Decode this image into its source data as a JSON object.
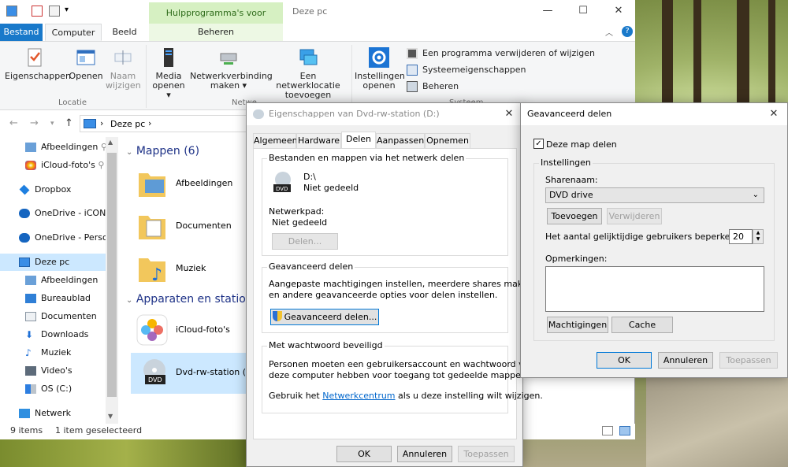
{
  "explorer": {
    "ctx_tab": "Hulpprogramma's voor stations",
    "title": "Deze pc",
    "tabs": [
      "Bestand",
      "Computer",
      "Beeld",
      "Beheren"
    ],
    "ribbon": {
      "eigenschappen": "Eigenschappen",
      "openen": "Openen",
      "naam_wijzigen": [
        "Naam",
        "wijzigen"
      ],
      "media_openen": [
        "Media",
        "openen ▾"
      ],
      "netwerkverbinding": [
        "Netwerkverbinding",
        "maken ▾"
      ],
      "netwerklocatie": [
        "Een netwerklocatie",
        "toevoegen"
      ],
      "instellingen": [
        "Instellingen",
        "openen"
      ],
      "programma": "Een programma verwijderen of wijzigen",
      "systeem": "Systeemeigenschappen",
      "beheren": "Beheren",
      "group_locatie": "Locatie",
      "group_netwerk": "Netwe",
      "group_systeem": "Systeem"
    },
    "address": "Deze pc",
    "nav": [
      {
        "label": "Afbeeldingen",
        "pinned": true
      },
      {
        "label": "iCloud-foto's",
        "pinned": true
      },
      {
        "label": "Dropbox"
      },
      {
        "label": "OneDrive - iCON I"
      },
      {
        "label": "OneDrive - Persor"
      },
      {
        "label": "Deze pc"
      },
      {
        "label": "Afbeeldingen"
      },
      {
        "label": "Bureaublad"
      },
      {
        "label": "Documenten"
      },
      {
        "label": "Downloads"
      },
      {
        "label": "Muziek"
      },
      {
        "label": "Video's"
      },
      {
        "label": "OS (C:)"
      },
      {
        "label": "Netwerk"
      }
    ],
    "sections": {
      "mappen": "Mappen (6)",
      "apparaten": "Apparaten en stations"
    },
    "folders": [
      "Afbeeldingen",
      "Documenten",
      "Muziek"
    ],
    "devices": [
      "iCloud-foto's",
      "Dvd-rw-station (D"
    ],
    "status_items": "9 items",
    "status_selected": "1 item geselecteerd"
  },
  "props": {
    "title": "Eigenschappen van Dvd-rw-station (D:)",
    "tabs": [
      "Algemeen",
      "Hardware",
      "Delen",
      "Aanpassen",
      "Opnemen"
    ],
    "share_group": "Bestanden en mappen via het netwerk delen",
    "drive": "D:\\",
    "drive_state": "Niet gedeeld",
    "netpath_label": "Netwerkpad:",
    "netpath_value": "Niet gedeeld",
    "share_btn": "Delen...",
    "adv_group": "Geavanceerd delen",
    "adv_desc1": "Aangepaste machtigingen instellen, meerdere shares maken",
    "adv_desc2": "en andere geavanceerde opties voor delen instellen.",
    "adv_btn": "Geavanceerd delen...",
    "pw_group": "Met wachtwoord beveiligd",
    "pw_desc1": "Personen moeten een gebruikersaccount en wachtwoord voor",
    "pw_desc2": "deze computer hebben voor toegang tot gedeelde mappen.",
    "pw_use": "Gebruik het",
    "pw_link": "Netwerkcentrum",
    "pw_rest": "als u deze instelling wilt wijzigen.",
    "ok": "OK",
    "cancel": "Annuleren",
    "apply": "Toepassen"
  },
  "adv": {
    "title": "Geavanceerd delen",
    "share_check": "Deze map delen",
    "settings": "Instellingen",
    "sharename_label": "Sharenaam:",
    "sharename_value": "DVD drive",
    "add": "Toevoegen",
    "remove": "Verwijderen",
    "limit_label": "Het aantal gelijktijdige gebruikers beperken tot:",
    "limit_value": "20",
    "comments_label": "Opmerkingen:",
    "permissions": "Machtigingen",
    "cache": "Cache",
    "ok": "OK",
    "cancel": "Annuleren",
    "apply": "Toepassen"
  }
}
